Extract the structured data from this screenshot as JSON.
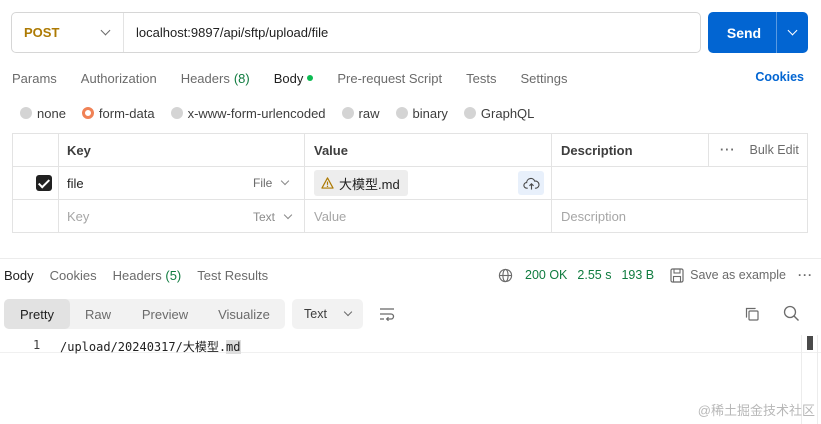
{
  "request": {
    "method": "POST",
    "url": "localhost:9897/api/sftp/upload/file",
    "send_label": "Send"
  },
  "request_tabs": [
    {
      "label": "Params"
    },
    {
      "label": "Authorization"
    },
    {
      "label": "Headers",
      "count": "(8)"
    },
    {
      "label": "Body",
      "active": true
    },
    {
      "label": "Pre-request Script"
    },
    {
      "label": "Tests"
    },
    {
      "label": "Settings"
    }
  ],
  "cookies_label": "Cookies",
  "body_types": [
    "none",
    "form-data",
    "x-www-form-urlencoded",
    "raw",
    "binary",
    "GraphQL"
  ],
  "body_selected": "form-data",
  "table": {
    "headers": {
      "key": "Key",
      "value": "Value",
      "description": "Description",
      "bulk_edit": "Bulk Edit"
    },
    "rows": [
      {
        "key": "file",
        "type": "File",
        "value": "大模型.md",
        "description": "",
        "checked": true
      }
    ],
    "placeholder": {
      "key": "Key",
      "type": "Text",
      "value": "Value",
      "description": "Description"
    }
  },
  "response": {
    "tabs": [
      {
        "label": "Body",
        "active": true
      },
      {
        "label": "Cookies"
      },
      {
        "label": "Headers",
        "count": "(5)"
      },
      {
        "label": "Test Results"
      }
    ],
    "status": "200 OK",
    "time": "2.55 s",
    "size": "193 B",
    "save_label": "Save as example",
    "views": [
      "Pretty",
      "Raw",
      "Preview",
      "Visualize"
    ],
    "active_view": "Pretty",
    "format": "Text",
    "line_number": "1",
    "body_main": "/upload/20240317/大模型.",
    "body_selected": "md"
  },
  "watermark": "@稀土掘金技术社区",
  "colors": {
    "accent": "#0265d2",
    "method": "#ad7a03",
    "status": "#0f7b3f",
    "radio_selected": "#f08256"
  }
}
